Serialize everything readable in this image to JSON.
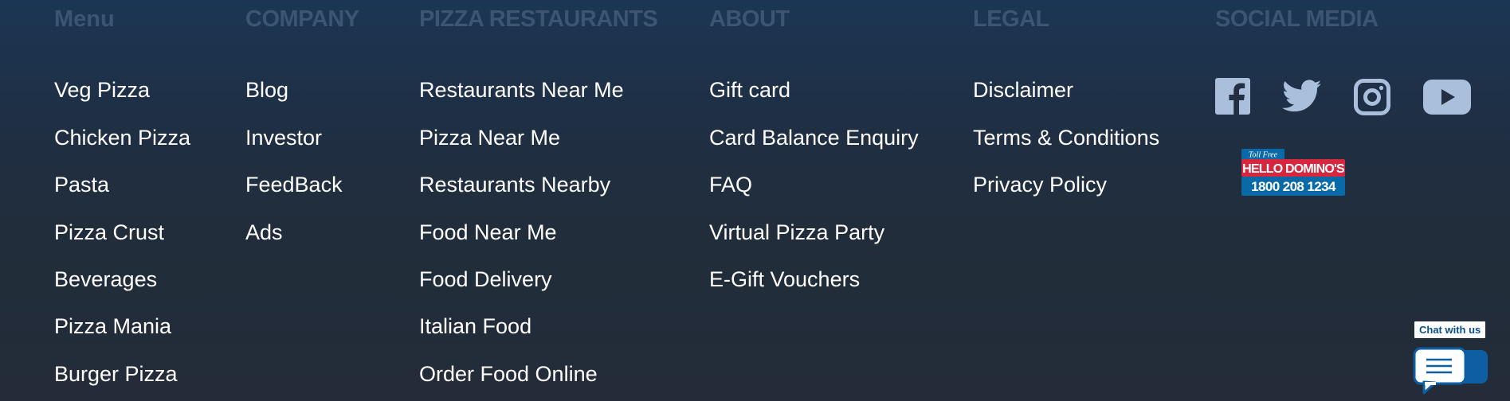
{
  "columns": {
    "menu": {
      "heading": "Menu",
      "links": [
        "Veg Pizza",
        "Chicken Pizza",
        "Pasta",
        "Pizza Crust",
        "Beverages",
        "Pizza Mania",
        "Burger Pizza"
      ]
    },
    "company": {
      "heading": "COMPANY",
      "links": [
        "Blog",
        "Investor",
        "FeedBack",
        "Ads"
      ]
    },
    "pizza_restaurants": {
      "heading": "PIZZA RESTAURANTS",
      "links": [
        "Restaurants Near Me",
        "Pizza Near Me",
        "Restaurants Nearby",
        "Food Near Me",
        "Food Delivery",
        "Italian Food",
        "Order Food Online"
      ]
    },
    "about": {
      "heading": "ABOUT",
      "links": [
        "Gift card",
        "Card Balance Enquiry",
        "FAQ",
        "Virtual Pizza Party",
        "E-Gift Vouchers"
      ]
    },
    "legal": {
      "heading": "LEGAL",
      "links": [
        "Disclaimer",
        "Terms & Conditions",
        "Privacy Policy"
      ]
    },
    "social": {
      "heading": "SOCIAL MEDIA",
      "icons": [
        "facebook-icon",
        "twitter-icon",
        "instagram-icon",
        "youtube-icon"
      ]
    }
  },
  "hotline": {
    "toll_free": "Toll Free",
    "brand": "HELLO DOMINO'S",
    "number": "1800 208 1234"
  },
  "chat": {
    "label": "Chat with us"
  },
  "colors": {
    "heading": "#3d5573",
    "link": "#ffffff",
    "social_icon": "#a9bfdc",
    "badge_red": "#d6273f",
    "badge_blue": "#0a6aa8"
  }
}
